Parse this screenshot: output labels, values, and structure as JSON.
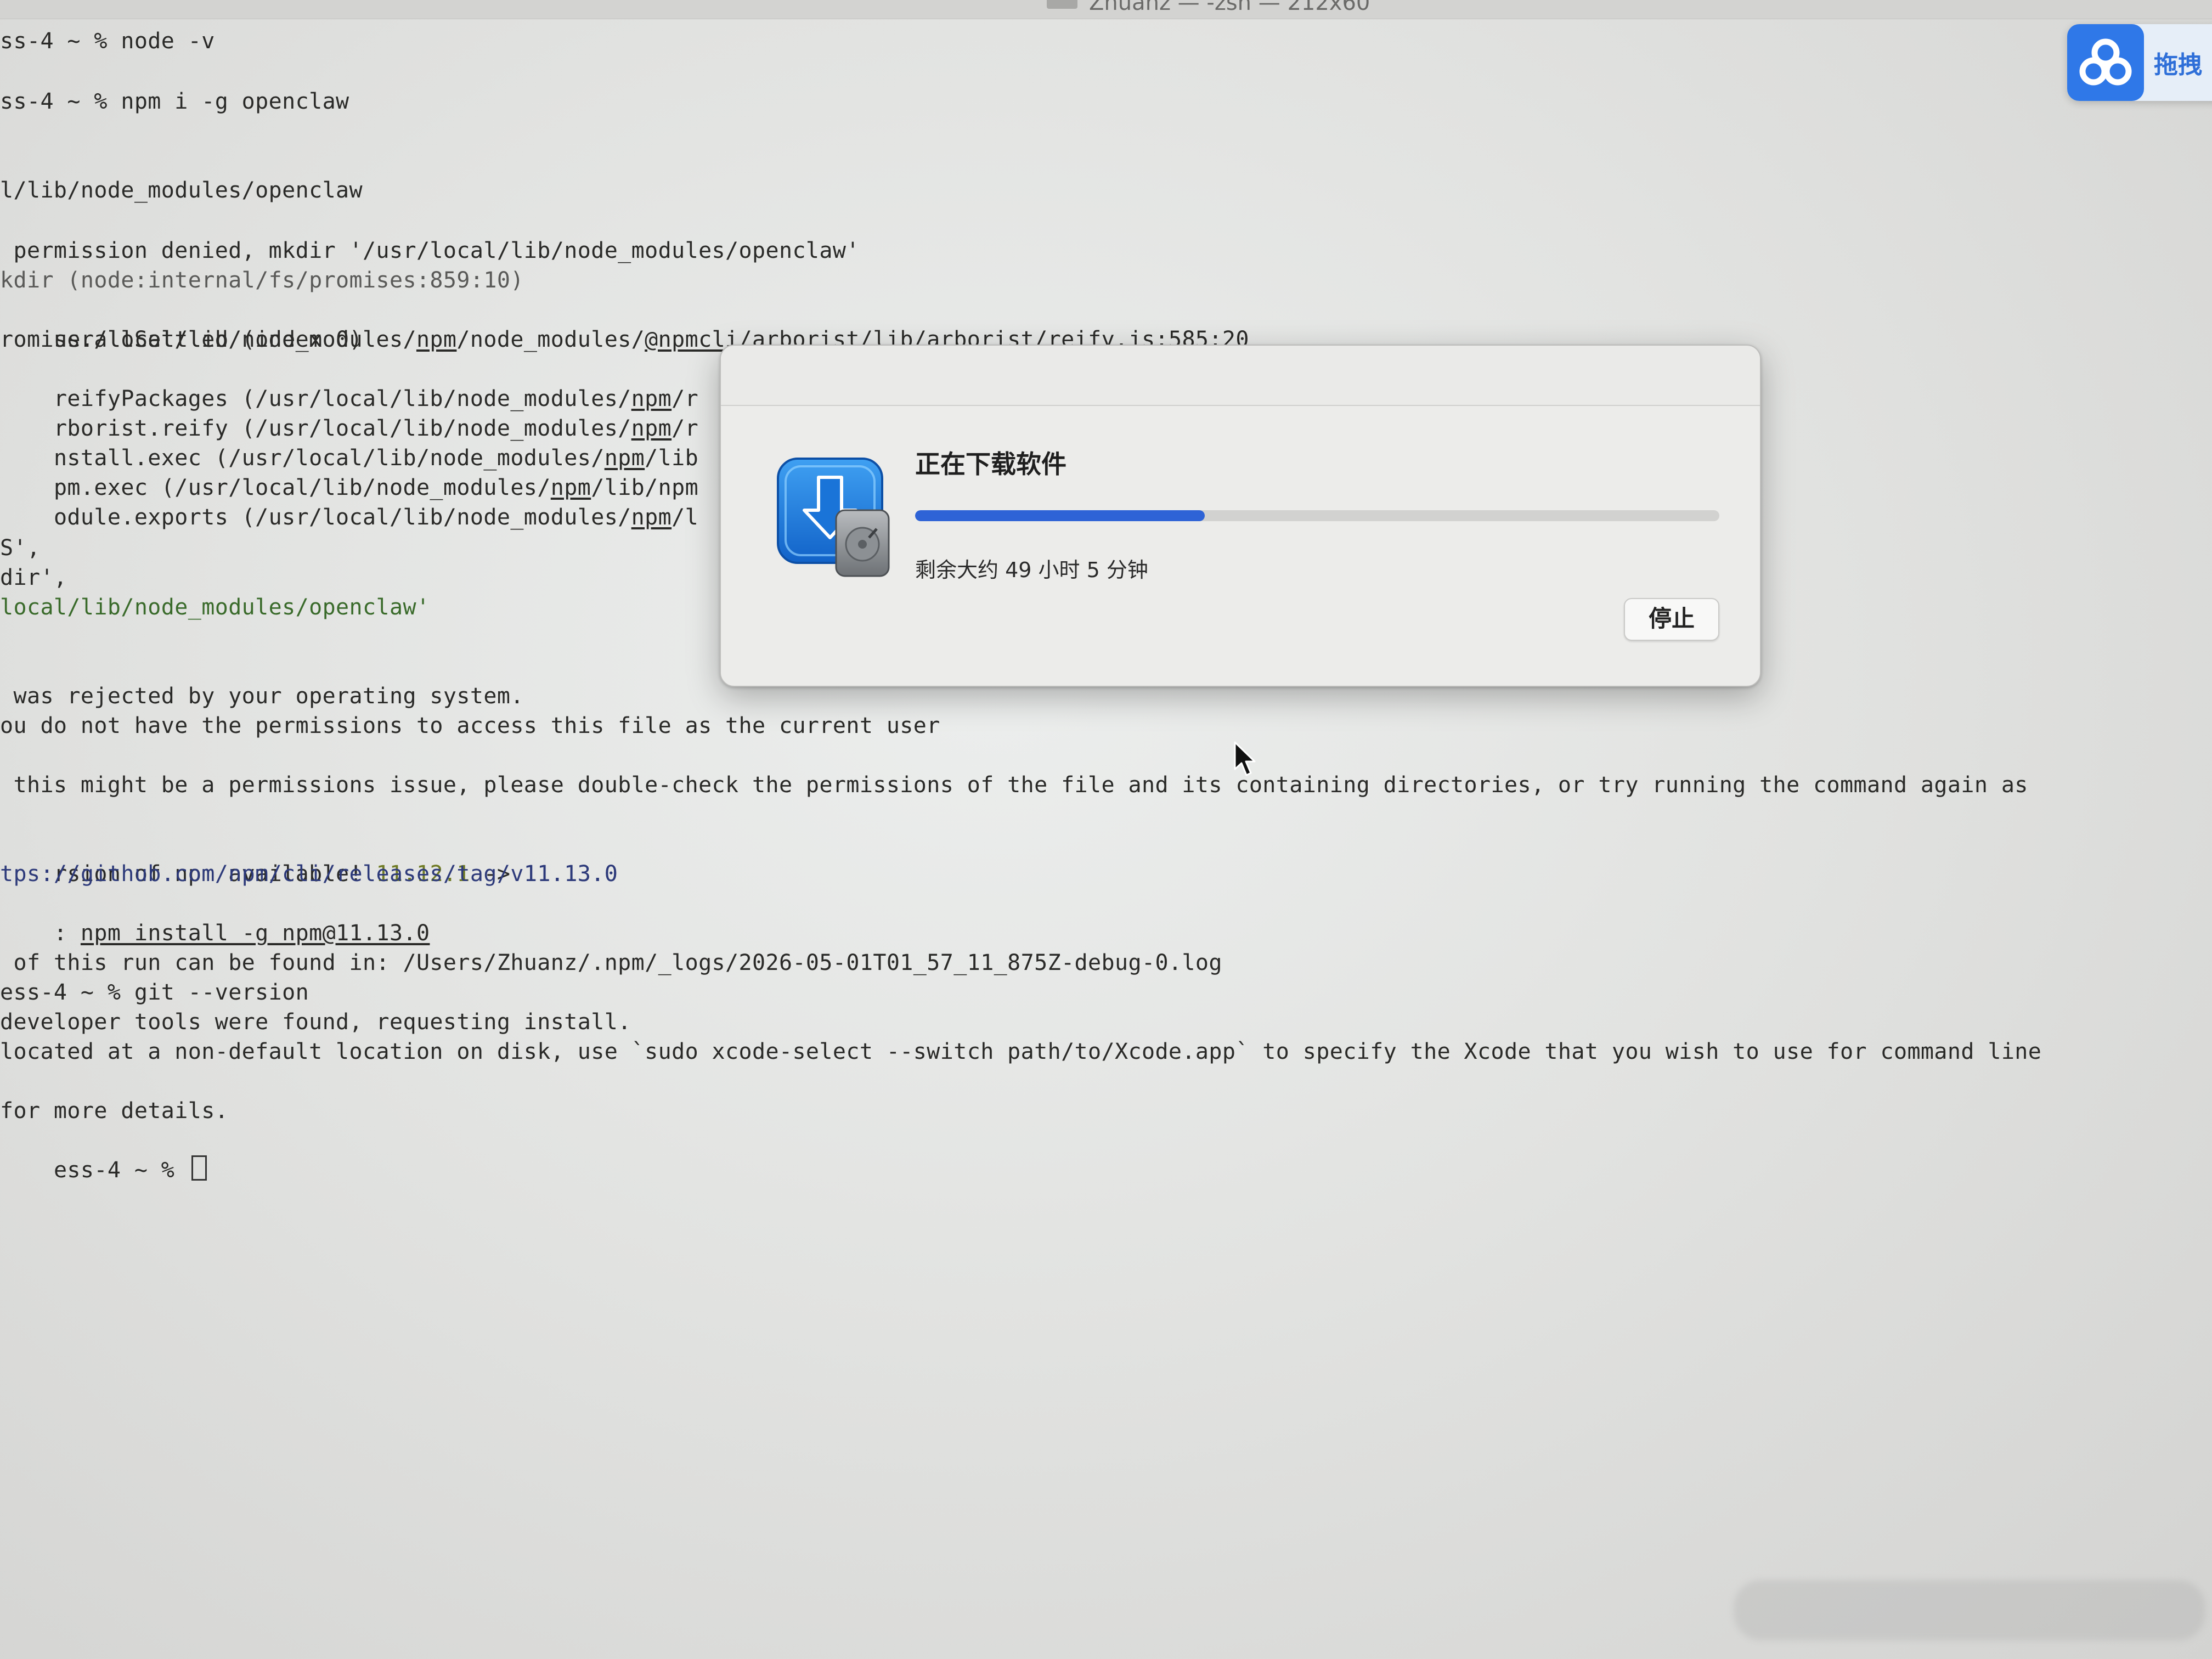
{
  "window": {
    "title": "Zhuanz — -zsh — 212x60"
  },
  "terminal": {
    "lines": {
      "l1": "ss-4 ~ % node -v",
      "l2": "ss-4 ~ % npm i -g openclaw",
      "l3": "l/lib/node_modules/openclaw",
      "l4": " permission denied, mkdir '/usr/local/lib/node_modules/openclaw'",
      "l5": "kdir (node:internal/fs/promises:859:10)",
      "l6a": "usr/local/lib/node_modules/",
      "l6b": "npm",
      "l6c": "/node_modules/",
      "l6d": "@npmcli/arborist",
      "l6e": "/lib/arborist/reify.js:585:20",
      "l7": "romise.allSettled (index 0)",
      "l8a": "reifyPackages (/usr/local/lib/node_modules/",
      "l8b": "npm",
      "l8c": "/r",
      "l9a": "rborist.reify (/usr/local/lib/node_modules/",
      "l9b": "npm",
      "l9c": "/r",
      "l10a": "nstall.exec (/usr/local/lib/node_modules/",
      "l10b": "npm",
      "l10c": "/lib",
      "l11a": "pm.exec (/usr/local/lib/node_modules/",
      "l11b": "npm",
      "l11c": "/lib/npm",
      "l12a": "odule.exports (/usr/local/lib/node_modules/",
      "l12b": "npm",
      "l12c": "/l",
      "l13": "S',",
      "l14": "dir',",
      "l15": "local/lib/node_modules/openclaw'",
      "l16": " was rejected by your operating system.",
      "l17": "ou do not have the permissions to access this file as the current user",
      "l18": " this might be a permissions issue, please double-check the permissions of the file and its containing directories, or try running the command again as",
      "l19a": "rsion of npm available! ",
      "l19b": "11.12.1",
      "l19c": " -> ",
      "l19d": "11.13.0",
      "l20": "tps://github.com/npm/cli/releases/tag/v11.13.0",
      "l21a": ": ",
      "l21b": "npm install -g npm@11.13.0",
      "l22": " of this run can be found in: /Users/Zhuanz/.npm/_logs/2026-05-01T01_57_11_875Z-debug-0.log",
      "l23": "ess-4 ~ % git --version",
      "l24": "developer tools were found, requesting install.",
      "l25": "located at a non-default location on disk, use `sudo xcode-select --switch path/to/Xcode.app` to specify the Xcode that you wish to use for command line",
      "l26": "for more details.",
      "l27": "ess-4 ~ % "
    }
  },
  "cloud_widget": {
    "label": "拖拽"
  },
  "dialog": {
    "title": "正在下载软件",
    "progress_fraction": 0.36,
    "remaining": "剩余大约 49 小时 5 分钟",
    "stop_label": "停止"
  },
  "colors": {
    "accent": "#2e63d6",
    "terminal_text": "#2a2a28",
    "version_old": "#6f7a24",
    "version_new": "#2d3a7a"
  }
}
